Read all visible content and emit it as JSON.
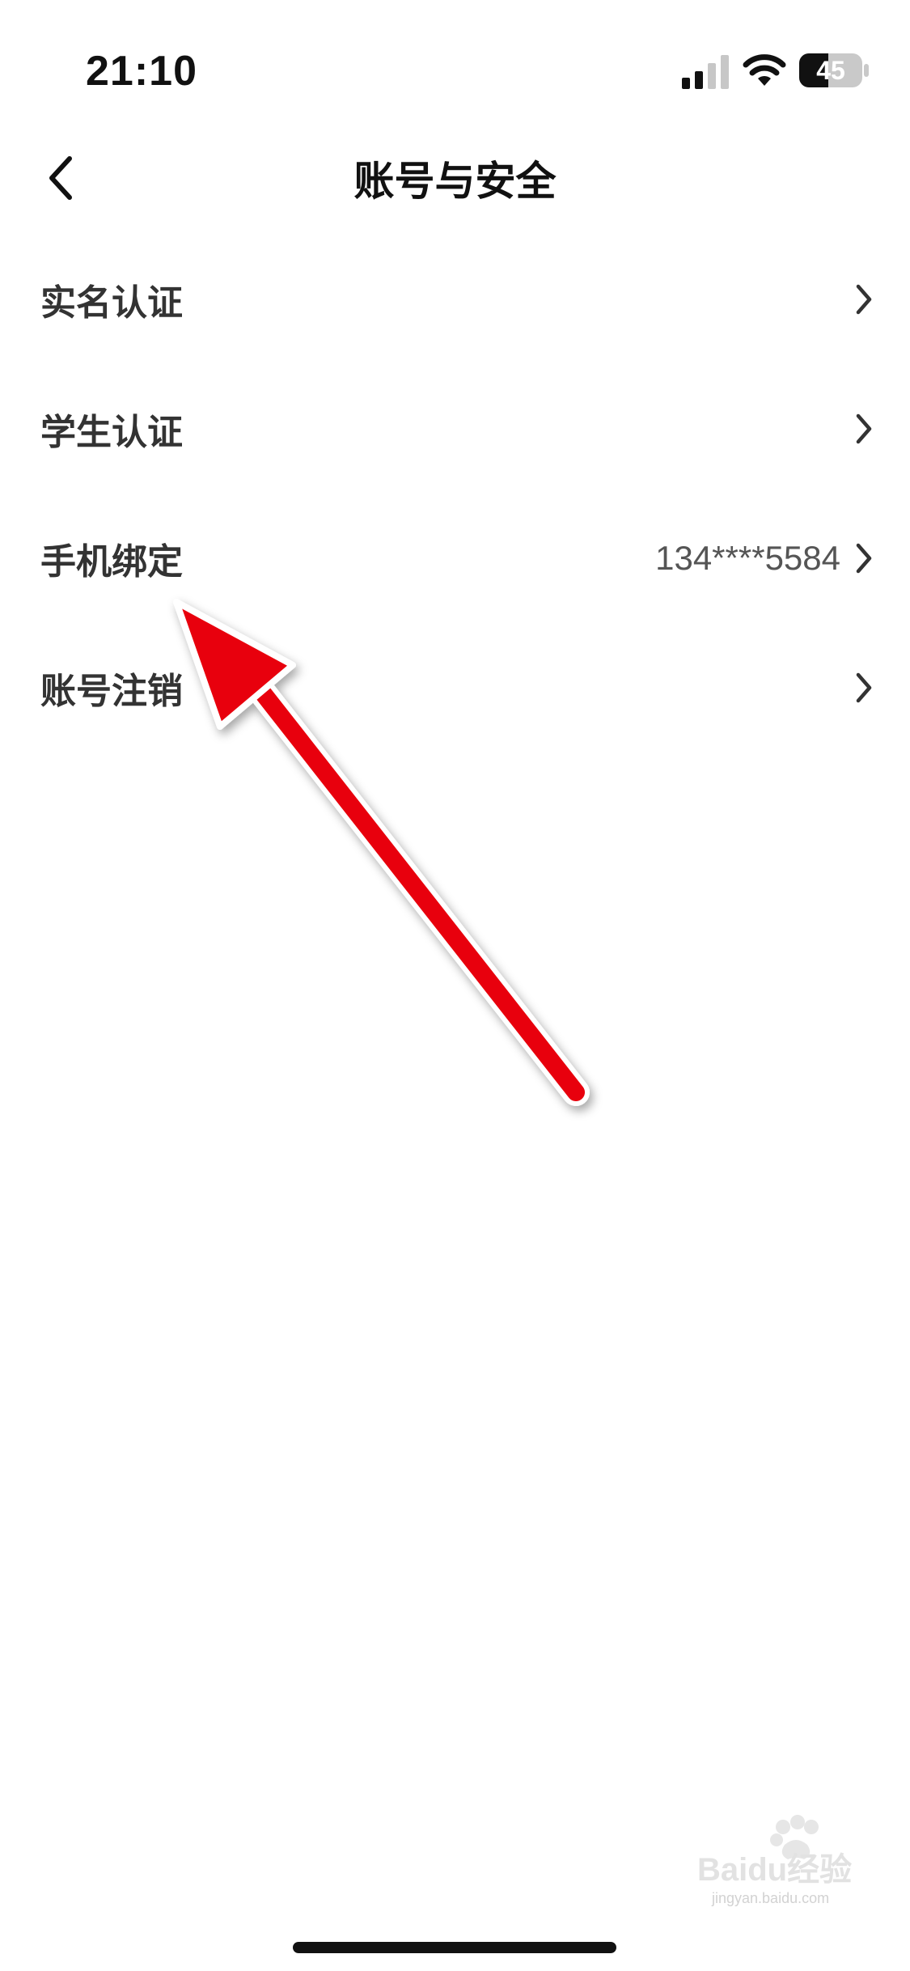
{
  "status_bar": {
    "time": "21:10",
    "battery_level": "45",
    "icons": [
      "signal-icon",
      "wifi-icon",
      "battery-icon"
    ]
  },
  "nav": {
    "back_icon": "chevron-left-icon",
    "title": "账号与安全"
  },
  "menu": [
    {
      "label": "实名认证",
      "value": ""
    },
    {
      "label": "学生认证",
      "value": ""
    },
    {
      "label": "手机绑定",
      "value": "134****5584"
    },
    {
      "label": "账号注销",
      "value": ""
    }
  ],
  "watermark": {
    "brand": "Baidu经验",
    "url": "jingyan.baidu.com"
  },
  "colors": {
    "text_primary": "#111111",
    "text_label": "#333333",
    "text_value": "#555555",
    "annotation_arrow": "#e8000b",
    "background": "#ffffff"
  }
}
